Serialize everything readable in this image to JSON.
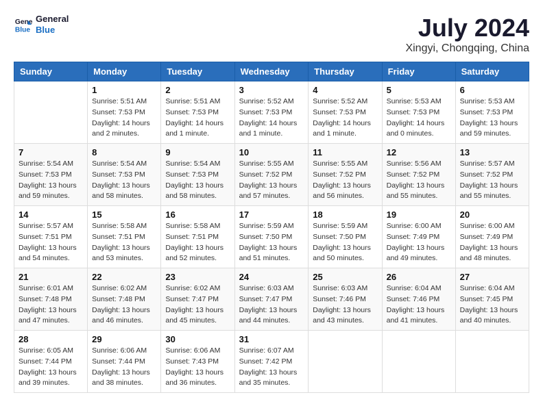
{
  "logo": {
    "line1": "General",
    "line2": "Blue"
  },
  "title": "July 2024",
  "subtitle": "Xingyi, Chongqing, China",
  "days_of_week": [
    "Sunday",
    "Monday",
    "Tuesday",
    "Wednesday",
    "Thursday",
    "Friday",
    "Saturday"
  ],
  "weeks": [
    [
      {
        "day": "",
        "info": ""
      },
      {
        "day": "1",
        "info": "Sunrise: 5:51 AM\nSunset: 7:53 PM\nDaylight: 14 hours\nand 2 minutes."
      },
      {
        "day": "2",
        "info": "Sunrise: 5:51 AM\nSunset: 7:53 PM\nDaylight: 14 hours\nand 1 minute."
      },
      {
        "day": "3",
        "info": "Sunrise: 5:52 AM\nSunset: 7:53 PM\nDaylight: 14 hours\nand 1 minute."
      },
      {
        "day": "4",
        "info": "Sunrise: 5:52 AM\nSunset: 7:53 PM\nDaylight: 14 hours\nand 1 minute."
      },
      {
        "day": "5",
        "info": "Sunrise: 5:53 AM\nSunset: 7:53 PM\nDaylight: 14 hours\nand 0 minutes."
      },
      {
        "day": "6",
        "info": "Sunrise: 5:53 AM\nSunset: 7:53 PM\nDaylight: 13 hours\nand 59 minutes."
      }
    ],
    [
      {
        "day": "7",
        "info": "Sunrise: 5:54 AM\nSunset: 7:53 PM\nDaylight: 13 hours\nand 59 minutes."
      },
      {
        "day": "8",
        "info": "Sunrise: 5:54 AM\nSunset: 7:53 PM\nDaylight: 13 hours\nand 58 minutes."
      },
      {
        "day": "9",
        "info": "Sunrise: 5:54 AM\nSunset: 7:53 PM\nDaylight: 13 hours\nand 58 minutes."
      },
      {
        "day": "10",
        "info": "Sunrise: 5:55 AM\nSunset: 7:52 PM\nDaylight: 13 hours\nand 57 minutes."
      },
      {
        "day": "11",
        "info": "Sunrise: 5:55 AM\nSunset: 7:52 PM\nDaylight: 13 hours\nand 56 minutes."
      },
      {
        "day": "12",
        "info": "Sunrise: 5:56 AM\nSunset: 7:52 PM\nDaylight: 13 hours\nand 55 minutes."
      },
      {
        "day": "13",
        "info": "Sunrise: 5:57 AM\nSunset: 7:52 PM\nDaylight: 13 hours\nand 55 minutes."
      }
    ],
    [
      {
        "day": "14",
        "info": "Sunrise: 5:57 AM\nSunset: 7:51 PM\nDaylight: 13 hours\nand 54 minutes."
      },
      {
        "day": "15",
        "info": "Sunrise: 5:58 AM\nSunset: 7:51 PM\nDaylight: 13 hours\nand 53 minutes."
      },
      {
        "day": "16",
        "info": "Sunrise: 5:58 AM\nSunset: 7:51 PM\nDaylight: 13 hours\nand 52 minutes."
      },
      {
        "day": "17",
        "info": "Sunrise: 5:59 AM\nSunset: 7:50 PM\nDaylight: 13 hours\nand 51 minutes."
      },
      {
        "day": "18",
        "info": "Sunrise: 5:59 AM\nSunset: 7:50 PM\nDaylight: 13 hours\nand 50 minutes."
      },
      {
        "day": "19",
        "info": "Sunrise: 6:00 AM\nSunset: 7:49 PM\nDaylight: 13 hours\nand 49 minutes."
      },
      {
        "day": "20",
        "info": "Sunrise: 6:00 AM\nSunset: 7:49 PM\nDaylight: 13 hours\nand 48 minutes."
      }
    ],
    [
      {
        "day": "21",
        "info": "Sunrise: 6:01 AM\nSunset: 7:48 PM\nDaylight: 13 hours\nand 47 minutes."
      },
      {
        "day": "22",
        "info": "Sunrise: 6:02 AM\nSunset: 7:48 PM\nDaylight: 13 hours\nand 46 minutes."
      },
      {
        "day": "23",
        "info": "Sunrise: 6:02 AM\nSunset: 7:47 PM\nDaylight: 13 hours\nand 45 minutes."
      },
      {
        "day": "24",
        "info": "Sunrise: 6:03 AM\nSunset: 7:47 PM\nDaylight: 13 hours\nand 44 minutes."
      },
      {
        "day": "25",
        "info": "Sunrise: 6:03 AM\nSunset: 7:46 PM\nDaylight: 13 hours\nand 43 minutes."
      },
      {
        "day": "26",
        "info": "Sunrise: 6:04 AM\nSunset: 7:46 PM\nDaylight: 13 hours\nand 41 minutes."
      },
      {
        "day": "27",
        "info": "Sunrise: 6:04 AM\nSunset: 7:45 PM\nDaylight: 13 hours\nand 40 minutes."
      }
    ],
    [
      {
        "day": "28",
        "info": "Sunrise: 6:05 AM\nSunset: 7:44 PM\nDaylight: 13 hours\nand 39 minutes."
      },
      {
        "day": "29",
        "info": "Sunrise: 6:06 AM\nSunset: 7:44 PM\nDaylight: 13 hours\nand 38 minutes."
      },
      {
        "day": "30",
        "info": "Sunrise: 6:06 AM\nSunset: 7:43 PM\nDaylight: 13 hours\nand 36 minutes."
      },
      {
        "day": "31",
        "info": "Sunrise: 6:07 AM\nSunset: 7:42 PM\nDaylight: 13 hours\nand 35 minutes."
      },
      {
        "day": "",
        "info": ""
      },
      {
        "day": "",
        "info": ""
      },
      {
        "day": "",
        "info": ""
      }
    ]
  ]
}
